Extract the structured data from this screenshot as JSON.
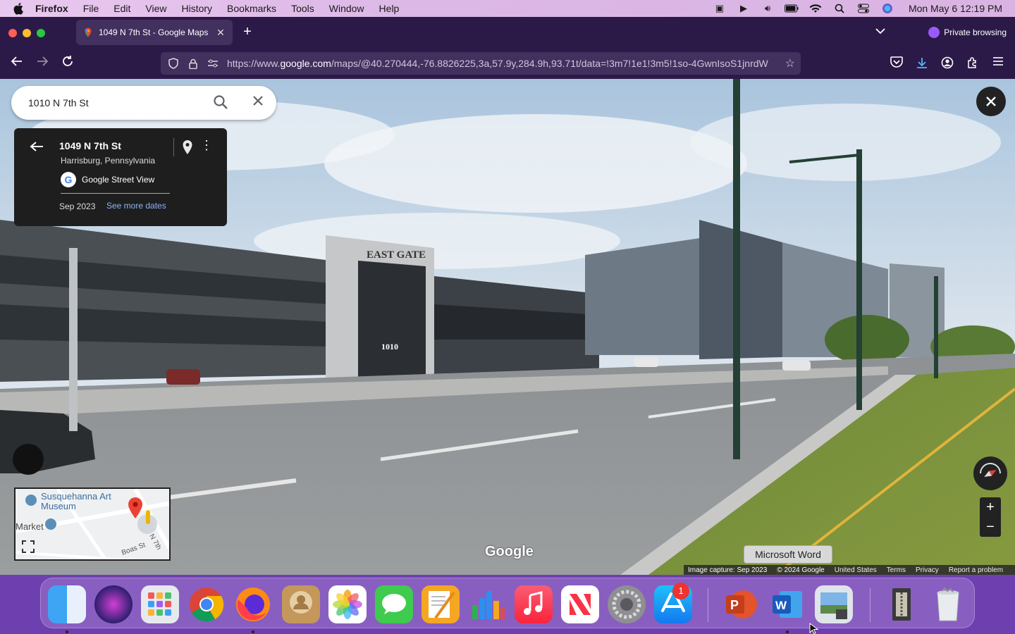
{
  "menubar": {
    "items": [
      "Firefox",
      "File",
      "Edit",
      "View",
      "History",
      "Bookmarks",
      "Tools",
      "Window",
      "Help"
    ],
    "clock": "Mon May 6  12:19 PM"
  },
  "browser": {
    "tab_title": "1049 N 7th St - Google Maps",
    "private_label": "Private browsing",
    "url_prefix": "https://www.",
    "url_domain": "google.com",
    "url_rest": "/maps/@40.270444,-76.8826225,3a,57.9y,284.9h,93.71t/data=!3m7!1e1!3m5!1so-4GwnIsoS1jnrdW"
  },
  "maps": {
    "search_value": "1010 N 7th St",
    "card": {
      "address": "1049 N 7th St",
      "city": "Harrisburg, Pennsylvania",
      "source": "Google Street View",
      "date": "Sep 2023",
      "more_dates": "See more dates"
    },
    "building_sign": "EAST GATE",
    "building_number": "1010",
    "minimap": {
      "poi": "Susquehanna Art Museum",
      "market": "Market",
      "street1": "N 7th",
      "street2": "Boas St"
    },
    "watermark": "Google",
    "tooltip": "Microsoft Word",
    "footer": {
      "capture": "Image capture: Sep 2023",
      "copyright": "© 2024 Google",
      "country": "United States",
      "terms": "Terms",
      "privacy": "Privacy",
      "report": "Report a problem"
    }
  },
  "dock": {
    "badge": "1",
    "apps": [
      "Finder",
      "Siri",
      "Launchpad",
      "Google Chrome",
      "Firefox",
      "Contacts",
      "Photos",
      "Messages",
      "Pages",
      "Numbers",
      "Music",
      "News",
      "System Settings",
      "App Store",
      "Microsoft PowerPoint",
      "Microsoft Word",
      "Preview",
      "Archive Utility",
      "Trash"
    ]
  },
  "colors": {
    "firefox_bg": "#2b1a47",
    "maps_blue": "#8ab4f8",
    "dock_bg": "#6e3fae"
  }
}
